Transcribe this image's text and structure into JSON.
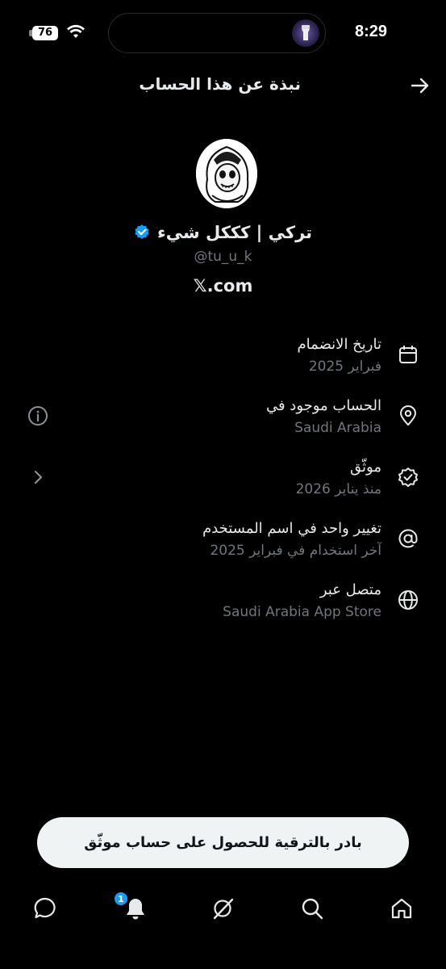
{
  "status_bar": {
    "battery": "76",
    "time": "8:29"
  },
  "header": {
    "title": "نبذة عن هذا الحساب"
  },
  "profile": {
    "display_name": "تركي | كككل شيء",
    "handle": "@tu_u_k",
    "website": "𝕏.com"
  },
  "rows": [
    {
      "title": "تاريخ الانضمام",
      "subtitle": "فبراير 2025",
      "icon": "calendar-icon"
    },
    {
      "title": "الحساب موجود في",
      "subtitle": "Saudi Arabia",
      "icon": "location-pin-icon",
      "action_icon": "info-icon"
    },
    {
      "title": "موثّق",
      "subtitle": "منذ يناير 2026",
      "icon": "verified-badge-icon",
      "action_icon": "chevron-left-icon"
    },
    {
      "title": "تغيير واحد في اسم المستخدم",
      "subtitle": "آخر استخدام في فبراير 2025",
      "icon": "at-sign-icon"
    },
    {
      "title": "متصل عبر",
      "subtitle": "Saudi Arabia App Store",
      "icon": "globe-icon"
    }
  ],
  "upgrade": {
    "label": "بادر بالترقية للحصول على حساب موثّق"
  },
  "bottom_nav": {
    "items": [
      "chat-icon",
      "bell-icon",
      "grok-icon",
      "search-icon",
      "home-icon"
    ],
    "notification_count": "1"
  },
  "colors": {
    "background": "#000000",
    "text_primary": "#e7e9ea",
    "text_secondary": "#71767b",
    "accent": "#1d9bf0"
  }
}
